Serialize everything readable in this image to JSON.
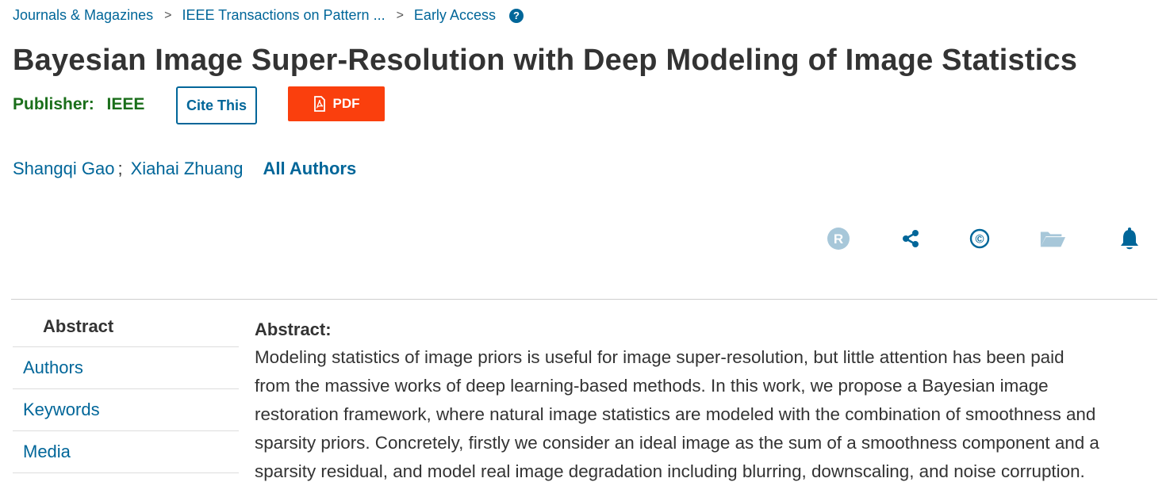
{
  "breadcrumb": {
    "items": [
      "Journals & Magazines",
      "IEEE Transactions on Pattern ...",
      "Early Access"
    ],
    "separator": ">",
    "help_icon": "?"
  },
  "title": "Bayesian Image Super-Resolution with Deep Modeling of Image Statistics",
  "publisher": {
    "label": "Publisher:",
    "name": "IEEE"
  },
  "actions": {
    "cite_label": "Cite This",
    "pdf_label": "PDF",
    "pdf_color": "#fa3f0d"
  },
  "authors": {
    "list": [
      "Shangqi Gao",
      "Xiahai Zhuang"
    ],
    "separator": ";",
    "all_authors_label": "All Authors"
  },
  "toolbar_icons": [
    "rights-icon",
    "share-icon",
    "copyright-icon",
    "folder-icon",
    "bell-icon"
  ],
  "toolbar_glyphs": {
    "rights": "R",
    "copyright": "©"
  },
  "side_nav": {
    "items": [
      "Abstract",
      "Authors",
      "Keywords",
      "Media"
    ]
  },
  "abstract": {
    "heading": "Abstract:",
    "lines": [
      "Modeling statistics of image priors is useful for image super-resolution, but little attention has been paid",
      "from the massive works of deep learning-based methods. In this work, we propose a Bayesian image",
      "restoration framework, where natural image statistics are modeled with the combination of smoothness and",
      "sparsity priors. Concretely, firstly we consider an ideal image as the sum of a smoothness component and a",
      "sparsity residual, and model real image degradation including blurring, downscaling, and noise corruption."
    ]
  },
  "colors": {
    "link": "#006699",
    "publisher": "#1a6e1a",
    "icon_muted": "#a7c7d9",
    "icon_strong": "#006699"
  }
}
